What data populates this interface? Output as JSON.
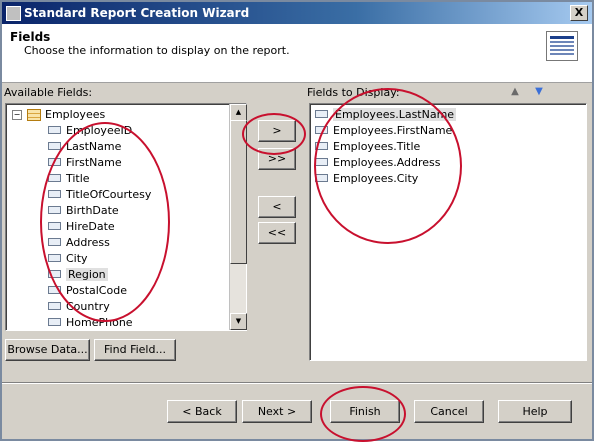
{
  "window": {
    "title": "Standard Report Creation Wizard",
    "close_label": "X"
  },
  "header": {
    "title": "Fields",
    "description": "Choose the information to display on the report."
  },
  "available": {
    "label": "Available Fields:",
    "root": "Employees",
    "items": [
      "EmployeeID",
      "LastName",
      "FirstName",
      "Title",
      "TitleOfCourtesy",
      "BirthDate",
      "HireDate",
      "Address",
      "City",
      "Region",
      "PostalCode",
      "Country",
      "HomePhone"
    ],
    "selected": "Region"
  },
  "display": {
    "label": "Fields to Display:",
    "items": [
      "Employees.LastName",
      "Employees.FirstName",
      "Employees.Title",
      "Employees.Address",
      "Employees.City"
    ],
    "selected": "Employees.LastName"
  },
  "move_buttons": {
    "add": ">",
    "add_all": ">>",
    "remove": "<",
    "remove_all": "<<"
  },
  "field_buttons": {
    "browse": "Browse Data...",
    "find": "Find Field..."
  },
  "footer": {
    "back": "< Back",
    "next": "Next >",
    "finish": "Finish",
    "cancel": "Cancel",
    "help": "Help"
  },
  "colors": {
    "annotation": "#c8102e",
    "titlebar": "#0a246a"
  }
}
